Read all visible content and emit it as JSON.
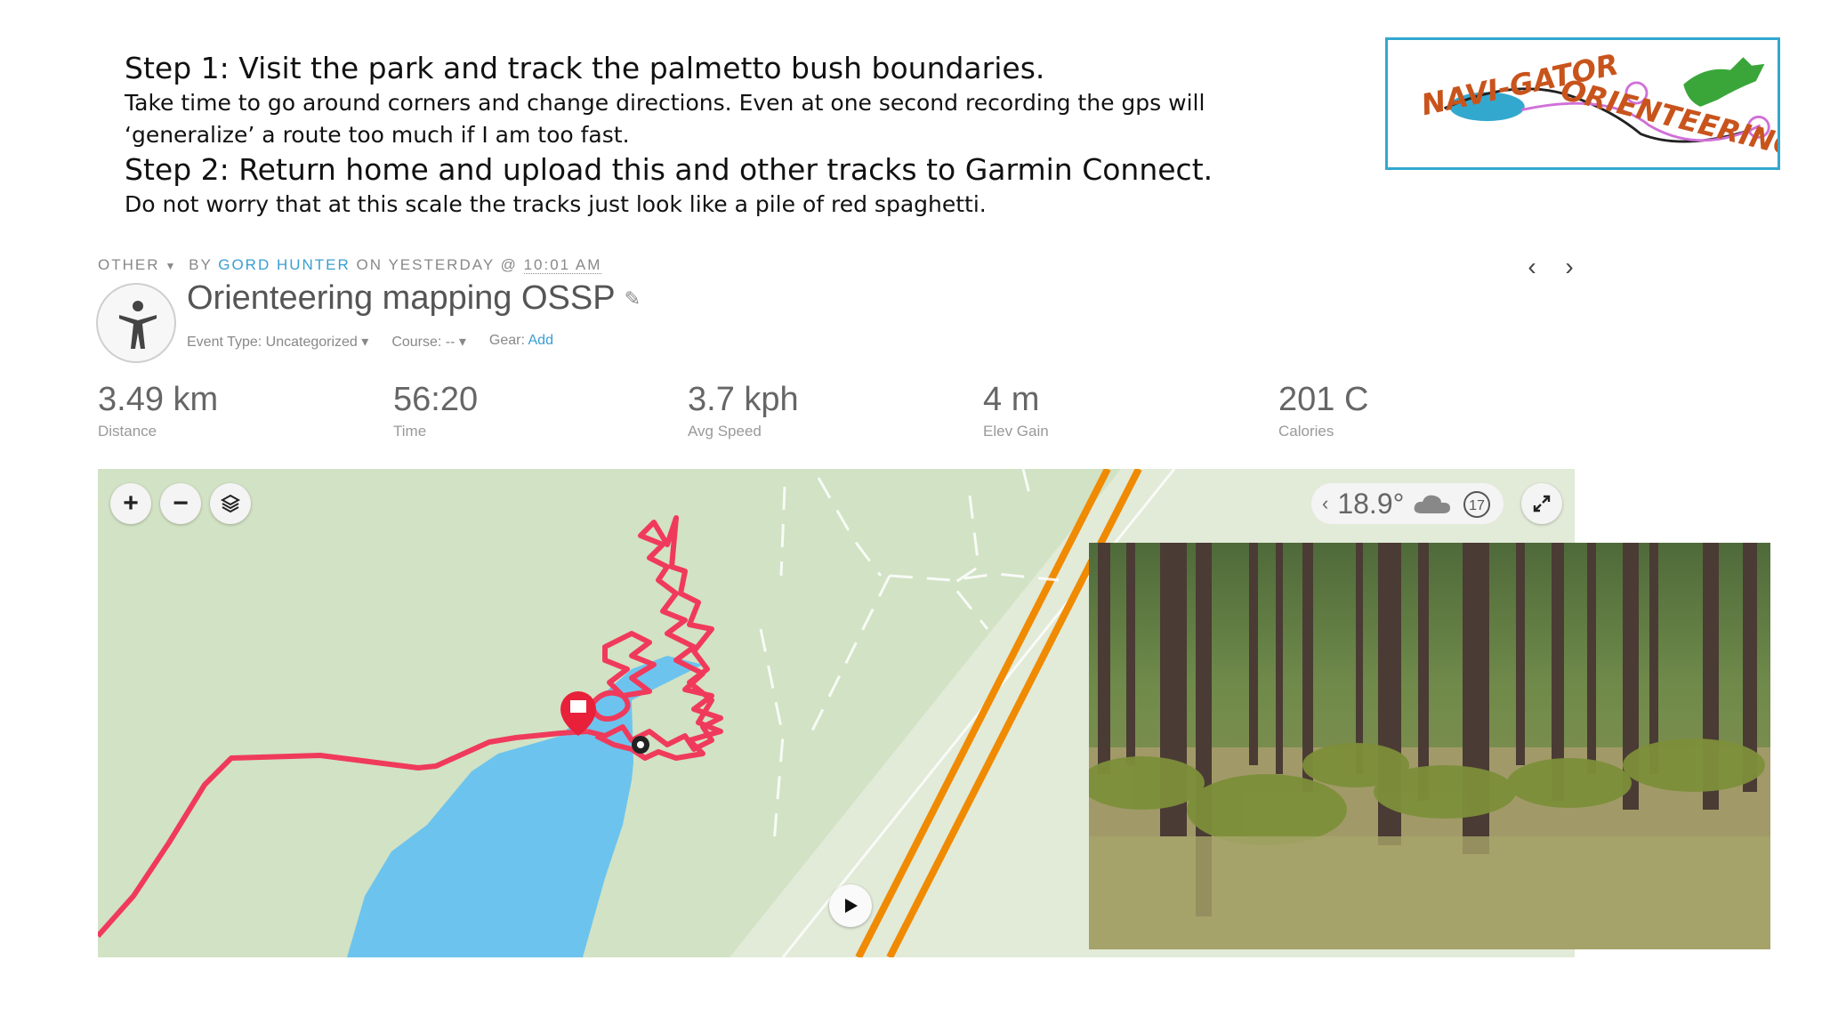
{
  "instructions": {
    "step1_title": "Step 1: Visit the park and track the palmetto bush boundaries.",
    "step1_body_line1": "Take time to go around corners and change directions. Even at one second recording the gps will",
    "step1_body_line2": "‘generalize’ a route too much if I am too fast.",
    "step2_title": "Step 2: Return home and upload this and other tracks to Garmin Connect.",
    "step2_body": "Do not worry that at this scale the tracks just look like a pile of red spaghetti."
  },
  "logo": {
    "text_line1": "NAVI-GATOR",
    "text_line2": "ORIENTEERING",
    "colors": {
      "border": "#33a8cf",
      "text": "#c8541c",
      "water": "#33a8cf",
      "gator": "#3aa63a",
      "route": "#d070d8"
    }
  },
  "activity_meta": {
    "category": "OTHER",
    "by": "BY",
    "author": "GORD HUNTER",
    "on": "ON YESTERDAY @",
    "time": "10:01 AM"
  },
  "activity": {
    "title": "Orienteering mapping OSSP",
    "event_type_label": "Event Type: Uncategorized",
    "course_label": "Course: --",
    "gear_label": "Gear:",
    "gear_add": "Add",
    "icon": "person-activity-icon"
  },
  "stats": [
    {
      "value": "3.49 km",
      "label": "Distance"
    },
    {
      "value": "56:20",
      "label": "Time"
    },
    {
      "value": "3.7 kph",
      "label": "Avg Speed"
    },
    {
      "value": "4 m",
      "label": "Elev Gain"
    },
    {
      "value": "201 C",
      "label": "Calories"
    }
  ],
  "map": {
    "temperature": "18.9°",
    "weather_icon": "cloud-icon",
    "timer_badge": "17",
    "colors": {
      "land": "#d2e2c4",
      "water": "#6cc4ee",
      "track": "#f03a5c",
      "road": "#f08a00"
    }
  },
  "colors": {
    "link": "#3a9ed3"
  }
}
